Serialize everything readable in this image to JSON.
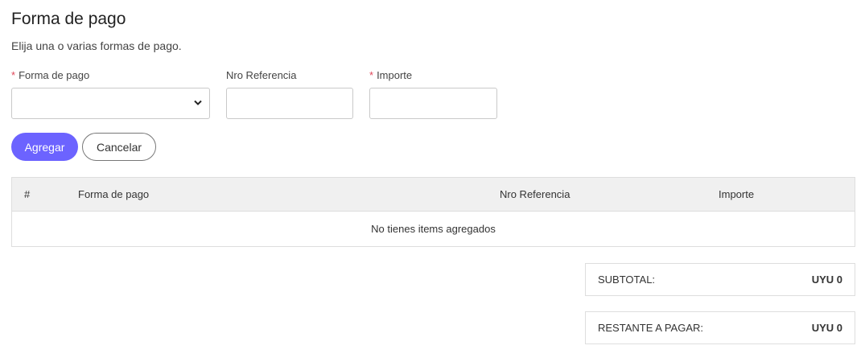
{
  "header": {
    "title": "Forma de pago",
    "subtitle": "Elija una o varias formas de pago."
  },
  "form": {
    "payment_method": {
      "required_mark": "*",
      "label": "Forma de pago",
      "value": ""
    },
    "reference": {
      "label": "Nro Referencia",
      "value": "",
      "placeholder": ""
    },
    "amount": {
      "required_mark": "*",
      "label": "Importe",
      "value": "",
      "placeholder": ""
    },
    "add_label": "Agregar",
    "cancel_label": "Cancelar",
    "colors": {
      "primary": "#6c63ff",
      "required": "#e0475a"
    }
  },
  "table": {
    "columns": [
      "#",
      "Forma de pago",
      "Nro Referencia",
      "Importe"
    ],
    "rows": [],
    "empty_message": "No tienes items agregados"
  },
  "summary": {
    "subtotal_label": "SUBTOTAL:",
    "subtotal_value": "UYU 0",
    "remaining_label": "RESTANTE A PAGAR:",
    "remaining_value": "UYU 0"
  }
}
